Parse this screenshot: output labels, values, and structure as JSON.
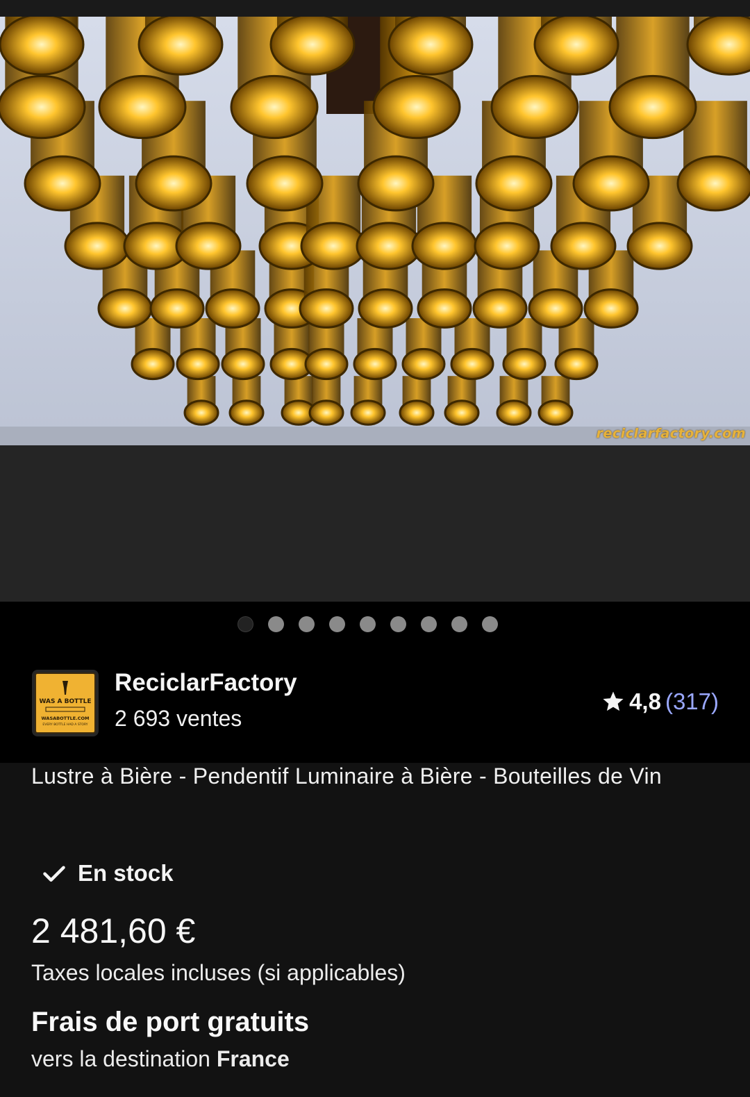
{
  "colors": {
    "background": "#121212",
    "accent_link": "#9aa8ff",
    "watermark": "#e7b23a",
    "logo_orange": "#f0b232"
  },
  "gallery": {
    "image_alt_icon": "chandelier-photo",
    "watermark": "reciclarfactory.com",
    "dot_count": 9,
    "active_index": 0
  },
  "shop": {
    "logo_icon": "shop-logo",
    "logo_text_top": "WAS A BOTTLE",
    "logo_text_bottom": "WASABOTTLE.COM",
    "logo_text_tagline": "EVERY BOTTLE HAD A STORY",
    "name": "ReciclarFactory",
    "sales": "2 693 ventes",
    "rating_icon": "star-icon",
    "rating": "4,8",
    "reviews": "(317)"
  },
  "listing": {
    "title": "Lustre à Bière - Pendentif Luminaire à Bière - Bouteilles de Vin",
    "stock_icon": "check-icon",
    "stock": "En stock",
    "price": "2 481,60 €",
    "taxes": "Taxes locales incluses (si applicables)",
    "shipping_title": "Frais de port gratuits",
    "shipping_dest_prefix": "vers la destination ",
    "shipping_dest_country": "France"
  }
}
